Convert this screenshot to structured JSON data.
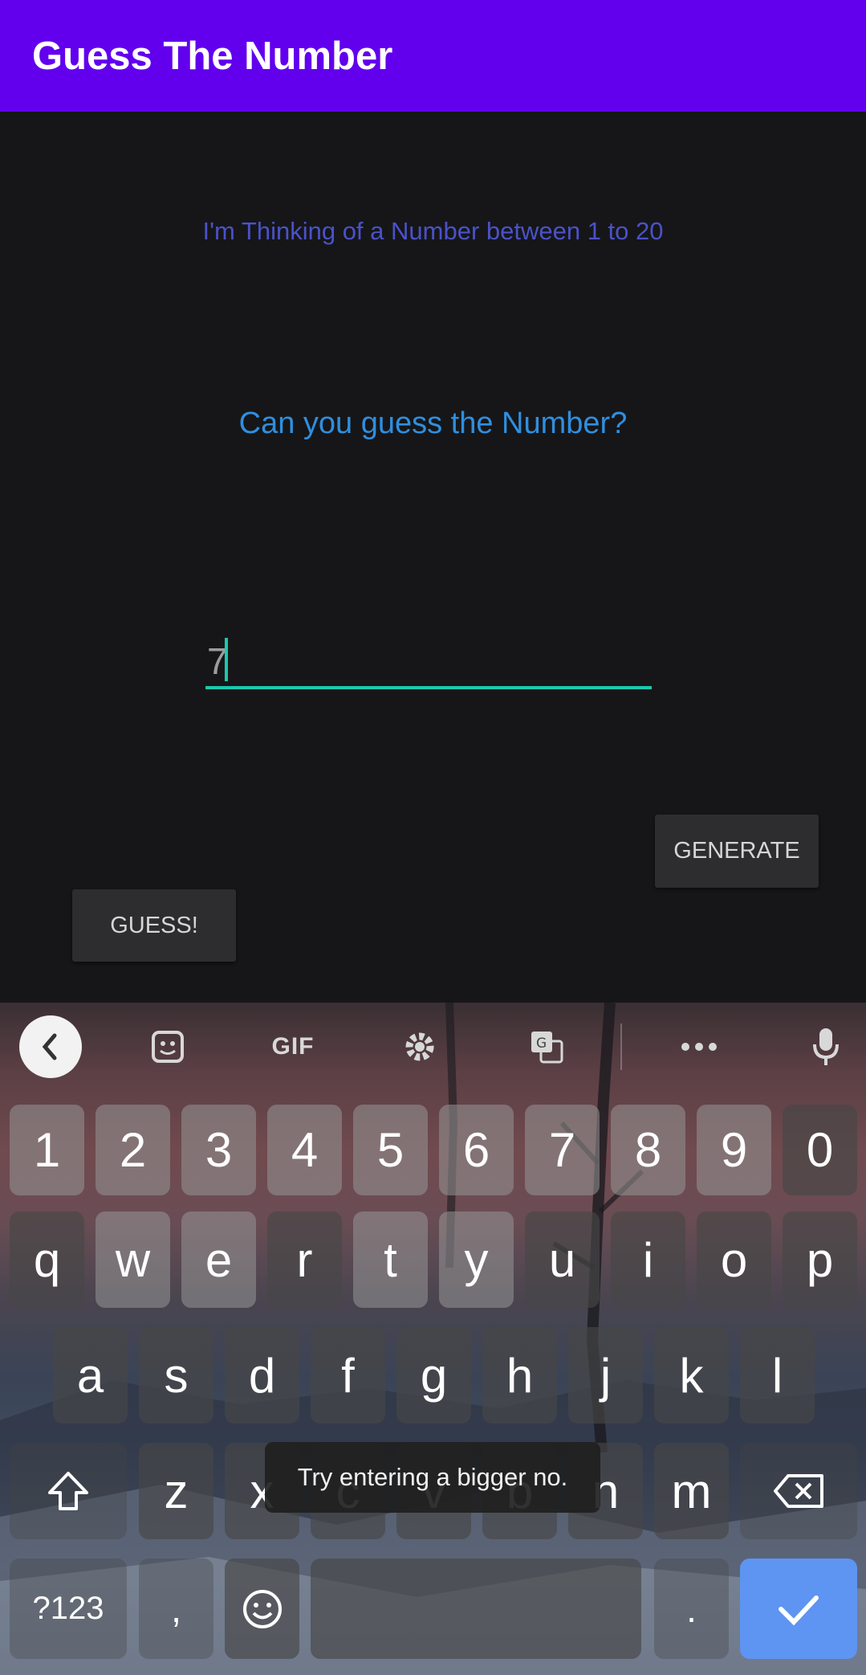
{
  "app_bar": {
    "title": "Guess The Number",
    "color": "#6200ee"
  },
  "main": {
    "subtitle": "I'm Thinking of a Number between 1 to 20",
    "question": "Can you guess the Number?",
    "input_value": "7",
    "generate_label": "GENERATE",
    "guess_label": "GUESS!"
  },
  "keyboard": {
    "toolbar": {
      "back": "chevron-left-icon",
      "sticker": "sticker-icon",
      "gif": "GIF",
      "settings": "gear-icon",
      "translate": "translate-icon",
      "more": "more-icon",
      "mic": "microphone-icon"
    },
    "number_row": [
      "1",
      "2",
      "3",
      "4",
      "5",
      "6",
      "7",
      "8",
      "9",
      "0"
    ],
    "row1": [
      "q",
      "w",
      "e",
      "r",
      "t",
      "y",
      "u",
      "i",
      "o",
      "p"
    ],
    "row2": [
      "a",
      "s",
      "d",
      "f",
      "g",
      "h",
      "j",
      "k",
      "l"
    ],
    "row3": [
      "z",
      "x",
      "c",
      "v",
      "b",
      "n",
      "m"
    ],
    "symbols_label": "?123",
    "comma": ",",
    "period": ".",
    "enter_color": "#5e94f2"
  },
  "toast": {
    "message": "Try entering a bigger no."
  }
}
